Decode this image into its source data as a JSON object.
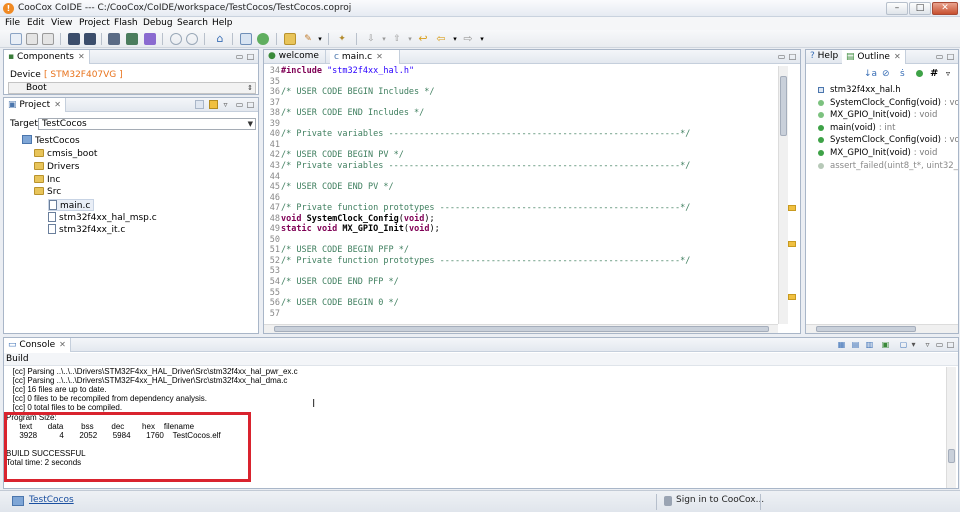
{
  "window": {
    "title": "CooCox CoIDE --- C:/CooCox/CoIDE/workspace/TestCocos/TestCocos.coproj",
    "min": "–",
    "max": "□",
    "close": "✕"
  },
  "menu": [
    "File",
    "Edit",
    "View",
    "Project",
    "Flash",
    "Debug",
    "Search",
    "Help"
  ],
  "components": {
    "tab": "Components",
    "device_label": "Device",
    "device_value": "[ STM32F407VG ]",
    "boot_label": "Boot"
  },
  "project": {
    "tab": "Project",
    "target_label": "Target",
    "target_value": "TestCocos",
    "tree": {
      "root": "TestCocos",
      "folders": [
        "cmsis_boot",
        "Drivers",
        "Inc",
        "Src"
      ],
      "src_files": [
        "main.c",
        "stm32f4xx_hal_msp.c",
        "stm32f4xx_it.c"
      ]
    }
  },
  "editor": {
    "tabs": [
      "welcome",
      "main.c"
    ],
    "lines": [
      {
        "n": "34",
        "parts": [
          {
            "t": "#include ",
            "c": "kw"
          },
          {
            "t": "\"stm32f4xx_hal.h\"",
            "c": "str"
          }
        ]
      },
      {
        "n": "35",
        "parts": []
      },
      {
        "n": "36",
        "parts": [
          {
            "t": "/* USER CODE BEGIN Includes */",
            "c": "cm"
          }
        ]
      },
      {
        "n": "37",
        "parts": []
      },
      {
        "n": "38",
        "parts": [
          {
            "t": "/* USER CODE END Includes */",
            "c": "cm"
          }
        ]
      },
      {
        "n": "39",
        "parts": []
      },
      {
        "n": "40",
        "parts": [
          {
            "t": "/* Private variables ---------------------------------------------------------*/",
            "c": "cm"
          }
        ]
      },
      {
        "n": "41",
        "parts": []
      },
      {
        "n": "42",
        "parts": [
          {
            "t": "/* USER CODE BEGIN PV */",
            "c": "cm"
          }
        ]
      },
      {
        "n": "43",
        "parts": [
          {
            "t": "/* Private variables ---------------------------------------------------------*/",
            "c": "cm"
          }
        ]
      },
      {
        "n": "44",
        "parts": []
      },
      {
        "n": "45",
        "parts": [
          {
            "t": "/* USER CODE END PV */",
            "c": "cm"
          }
        ]
      },
      {
        "n": "46",
        "parts": []
      },
      {
        "n": "47",
        "parts": [
          {
            "t": "/* Private function prototypes -----------------------------------------------*/",
            "c": "cm"
          }
        ]
      },
      {
        "n": "48",
        "parts": [
          {
            "t": "void ",
            "c": "kw"
          },
          {
            "t": "SystemClock_Config",
            "c": "fn"
          },
          {
            "t": "(",
            "c": ""
          },
          {
            "t": "void",
            "c": "kw"
          },
          {
            "t": ");",
            "c": ""
          }
        ]
      },
      {
        "n": "49",
        "parts": [
          {
            "t": "static void ",
            "c": "kw"
          },
          {
            "t": "MX_GPIO_Init",
            "c": "fn"
          },
          {
            "t": "(",
            "c": ""
          },
          {
            "t": "void",
            "c": "kw"
          },
          {
            "t": ");",
            "c": ""
          }
        ]
      },
      {
        "n": "50",
        "parts": []
      },
      {
        "n": "51",
        "parts": [
          {
            "t": "/* USER CODE BEGIN PFP */",
            "c": "cm"
          }
        ]
      },
      {
        "n": "52",
        "parts": [
          {
            "t": "/* Private function prototypes -----------------------------------------------*/",
            "c": "cm"
          }
        ]
      },
      {
        "n": "53",
        "parts": []
      },
      {
        "n": "54",
        "parts": [
          {
            "t": "/* USER CODE END PFP */",
            "c": "cm"
          }
        ]
      },
      {
        "n": "55",
        "parts": []
      },
      {
        "n": "56",
        "parts": [
          {
            "t": "/* USER CODE BEGIN 0 */",
            "c": "cm"
          }
        ]
      },
      {
        "n": "57",
        "parts": []
      }
    ]
  },
  "help_tab": "Help",
  "outline": {
    "tab": "Outline",
    "items": [
      {
        "name": "stm32f4xx_hal.h",
        "type": "",
        "muted": false,
        "icon": "include-icon"
      },
      {
        "name": "SystemClock_Config(void)",
        "type": ": void",
        "muted": false,
        "icon": "function-decl-icon"
      },
      {
        "name": "MX_GPIO_Init(void)",
        "type": ": void",
        "muted": false,
        "icon": "static-function-decl-icon"
      },
      {
        "name": "main(void)",
        "type": ": int",
        "muted": false,
        "icon": "function-icon"
      },
      {
        "name": "SystemClock_Config(void)",
        "type": ": void",
        "muted": false,
        "icon": "function-icon"
      },
      {
        "name": "MX_GPIO_Init(void)",
        "type": ": void",
        "muted": false,
        "icon": "function-icon"
      },
      {
        "name": "assert_failed(uint8_t*, uint32_t",
        "type": "",
        "muted": true,
        "icon": "disabled-function-icon"
      }
    ]
  },
  "console": {
    "tab": "Console",
    "build_label": "Build",
    "lines": [
      "   [cc] Parsing ..\\..\\..\\Drivers\\STM32F4xx_HAL_Driver\\Src\\stm32f4xx_hal_pwr_ex.c",
      "   [cc] Parsing ..\\..\\..\\Drivers\\STM32F4xx_HAL_Driver\\Src\\stm32f4xx_hal_dma.c",
      "   [cc] 16 files are up to date.",
      "   [cc] 0 files to be recompiled from dependency analysis.",
      "   [cc] 0 total files to be compiled.",
      "Program Size:",
      "      text       data        bss        dec        hex    filename",
      "      3928          4       2052       5984       1760    TestCocos.elf",
      "",
      "BUILD SUCCESSFUL",
      "Total time: 2 seconds"
    ],
    "highlight_color": "#d9232e"
  },
  "status": {
    "project": "TestCocos",
    "signin": "Sign in to CooCox..."
  }
}
